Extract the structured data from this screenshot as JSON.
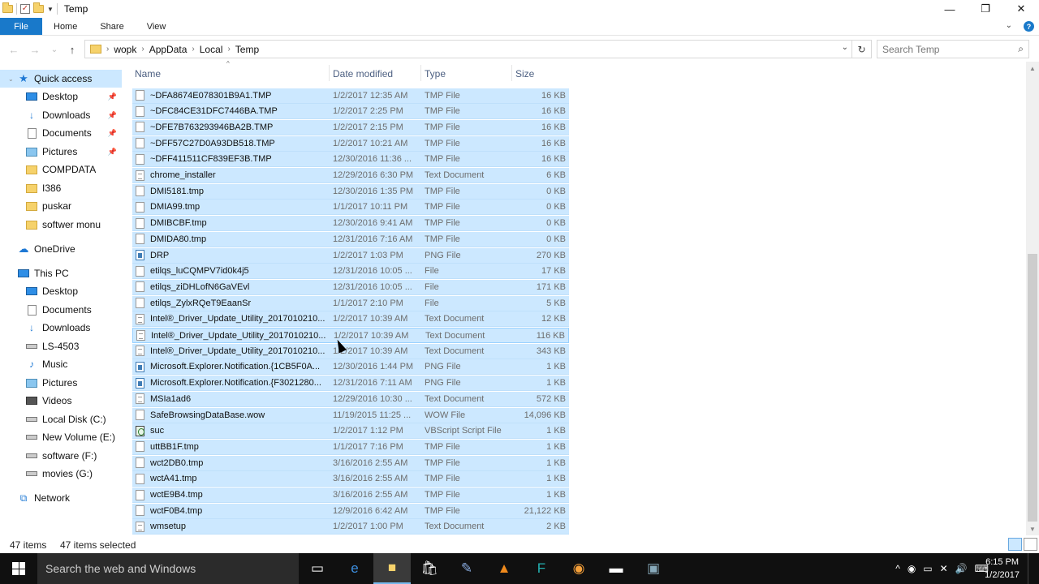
{
  "window": {
    "title": "Temp",
    "controls": {
      "minimize": "—",
      "maximize": "❐",
      "close": "✕"
    }
  },
  "ribbon": {
    "tabs": [
      "File",
      "Home",
      "Share",
      "View"
    ],
    "expand_icon": "chevron-down-icon",
    "help": "?"
  },
  "address": {
    "back": "←",
    "forward": "→",
    "recent": "⌄",
    "up": "↑",
    "crumbs": [
      "wopk",
      "AppData",
      "Local",
      "Temp"
    ],
    "dropdown": "⌄",
    "refresh": "↻"
  },
  "search": {
    "placeholder": "Search Temp",
    "icon": "⌕"
  },
  "navpane": {
    "quick_access": "Quick access",
    "qa_items": [
      {
        "label": "Desktop",
        "icon": "desktop-icon",
        "pinned": true
      },
      {
        "label": "Downloads",
        "icon": "downloads-icon",
        "pinned": true
      },
      {
        "label": "Documents",
        "icon": "documents-icon",
        "pinned": true
      },
      {
        "label": "Pictures",
        "icon": "pictures-icon",
        "pinned": true
      },
      {
        "label": "COMPDATA",
        "icon": "folder-icon"
      },
      {
        "label": "I386",
        "icon": "folder-icon"
      },
      {
        "label": "puskar",
        "icon": "folder-icon"
      },
      {
        "label": "softwer monu",
        "icon": "folder-icon"
      }
    ],
    "onedrive": "OneDrive",
    "this_pc": "This PC",
    "pc_items": [
      {
        "label": "Desktop",
        "icon": "desktop-icon"
      },
      {
        "label": "Documents",
        "icon": "documents-icon"
      },
      {
        "label": "Downloads",
        "icon": "downloads-icon"
      },
      {
        "label": "LS-4503",
        "icon": "drive-icon"
      },
      {
        "label": "Music",
        "icon": "music-icon"
      },
      {
        "label": "Pictures",
        "icon": "pictures-icon"
      },
      {
        "label": "Videos",
        "icon": "videos-icon"
      },
      {
        "label": "Local Disk (C:)",
        "icon": "drive-icon"
      },
      {
        "label": "New Volume (E:)",
        "icon": "drive-icon"
      },
      {
        "label": "software (F:)",
        "icon": "drive-icon"
      },
      {
        "label": "movies (G:)",
        "icon": "drive-icon"
      }
    ],
    "network": "Network"
  },
  "columns": {
    "name": "Name",
    "date": "Date modified",
    "type": "Type",
    "size": "Size"
  },
  "files": [
    {
      "name": "~DFA8674E078301B9A1.TMP",
      "date": "1/2/2017 12:35 AM",
      "type": "TMP File",
      "size": "16 KB",
      "icon": "file-icon"
    },
    {
      "name": "~DFC84CE31DFC7446BA.TMP",
      "date": "1/2/2017 2:25 PM",
      "type": "TMP File",
      "size": "16 KB",
      "icon": "file-icon"
    },
    {
      "name": "~DFE7B763293946BA2B.TMP",
      "date": "1/2/2017 2:15 PM",
      "type": "TMP File",
      "size": "16 KB",
      "icon": "file-icon"
    },
    {
      "name": "~DFF57C27D0A93DB518.TMP",
      "date": "1/2/2017 10:21 AM",
      "type": "TMP File",
      "size": "16 KB",
      "icon": "file-icon"
    },
    {
      "name": "~DFF411511CF839EF3B.TMP",
      "date": "12/30/2016 11:36 ...",
      "type": "TMP File",
      "size": "16 KB",
      "icon": "file-icon"
    },
    {
      "name": "chrome_installer",
      "date": "12/29/2016 6:30 PM",
      "type": "Text Document",
      "size": "6 KB",
      "icon": "text-file-icon"
    },
    {
      "name": "DMI5181.tmp",
      "date": "12/30/2016 1:35 PM",
      "type": "TMP File",
      "size": "0 KB",
      "icon": "file-icon"
    },
    {
      "name": "DMIA99.tmp",
      "date": "1/1/2017 10:11 PM",
      "type": "TMP File",
      "size": "0 KB",
      "icon": "file-icon"
    },
    {
      "name": "DMIBCBF.tmp",
      "date": "12/30/2016 9:41 AM",
      "type": "TMP File",
      "size": "0 KB",
      "icon": "file-icon"
    },
    {
      "name": "DMIDA80.tmp",
      "date": "12/31/2016 7:16 AM",
      "type": "TMP File",
      "size": "0 KB",
      "icon": "file-icon"
    },
    {
      "name": "DRP",
      "date": "1/2/2017 1:03 PM",
      "type": "PNG File",
      "size": "270 KB",
      "icon": "image-file-icon"
    },
    {
      "name": "etilqs_luCQMPV7id0k4j5",
      "date": "12/31/2016 10:05 ...",
      "type": "File",
      "size": "17 KB",
      "icon": "file-icon"
    },
    {
      "name": "etilqs_ziDHLofN6GaVEvl",
      "date": "12/31/2016 10:05 ...",
      "type": "File",
      "size": "171 KB",
      "icon": "file-icon"
    },
    {
      "name": "etilqs_ZylxRQeT9EaanSr",
      "date": "1/1/2017 2:10 PM",
      "type": "File",
      "size": "5 KB",
      "icon": "file-icon"
    },
    {
      "name": "Intel®_Driver_Update_Utility_2017010210...",
      "date": "1/2/2017 10:39 AM",
      "type": "Text Document",
      "size": "12 KB",
      "icon": "text-file-icon"
    },
    {
      "name": "Intel®_Driver_Update_Utility_2017010210...",
      "date": "1/2/2017 10:39 AM",
      "type": "Text Document",
      "size": "116 KB",
      "icon": "text-file-icon"
    },
    {
      "name": "Intel®_Driver_Update_Utility_2017010210...",
      "date": "1/2/2017 10:39 AM",
      "type": "Text Document",
      "size": "343 KB",
      "icon": "text-file-icon"
    },
    {
      "name": "Microsoft.Explorer.Notification.{1CB5F0A...",
      "date": "12/30/2016 1:44 PM",
      "type": "PNG File",
      "size": "1 KB",
      "icon": "image-file-icon"
    },
    {
      "name": "Microsoft.Explorer.Notification.{F3021280...",
      "date": "12/31/2016 7:11 AM",
      "type": "PNG File",
      "size": "1 KB",
      "icon": "image-file-icon"
    },
    {
      "name": "MSIa1ad6",
      "date": "12/29/2016 10:30 ...",
      "type": "Text Document",
      "size": "572 KB",
      "icon": "text-file-icon"
    },
    {
      "name": "SafeBrowsingDataBase.wow",
      "date": "11/19/2015 11:25 ...",
      "type": "WOW File",
      "size": "14,096 KB",
      "icon": "file-icon"
    },
    {
      "name": "suc",
      "date": "1/2/2017 1:12 PM",
      "type": "VBScript Script File",
      "size": "1 KB",
      "icon": "script-file-icon"
    },
    {
      "name": "uttBB1F.tmp",
      "date": "1/1/2017 7:16 PM",
      "type": "TMP File",
      "size": "1 KB",
      "icon": "file-icon"
    },
    {
      "name": "wct2DB0.tmp",
      "date": "3/16/2016 2:55 AM",
      "type": "TMP File",
      "size": "1 KB",
      "icon": "file-icon"
    },
    {
      "name": "wctA41.tmp",
      "date": "3/16/2016 2:55 AM",
      "type": "TMP File",
      "size": "1 KB",
      "icon": "file-icon"
    },
    {
      "name": "wctE9B4.tmp",
      "date": "3/16/2016 2:55 AM",
      "type": "TMP File",
      "size": "1 KB",
      "icon": "file-icon"
    },
    {
      "name": "wctF0B4.tmp",
      "date": "12/9/2016 6:42 AM",
      "type": "TMP File",
      "size": "21,122 KB",
      "icon": "file-icon"
    },
    {
      "name": "wmsetup",
      "date": "1/2/2017 1:00 PM",
      "type": "Text Document",
      "size": "2 KB",
      "icon": "text-file-icon"
    }
  ],
  "status": {
    "count": "47 items",
    "selected": "47 items selected"
  },
  "taskbar": {
    "search_placeholder": "Search the web and Windows",
    "time": "6:15 PM",
    "date": "1/2/2017",
    "apps": [
      "task-view-icon",
      "edge-icon",
      "file-explorer-icon",
      "store-icon",
      "paint-icon",
      "vlc-icon",
      "f-app-icon",
      "app-icon",
      "terminal-icon",
      "display-icon"
    ]
  },
  "colors": {
    "selection": "#cce8ff",
    "accent": "#1979ca",
    "taskbar": "#101010"
  }
}
